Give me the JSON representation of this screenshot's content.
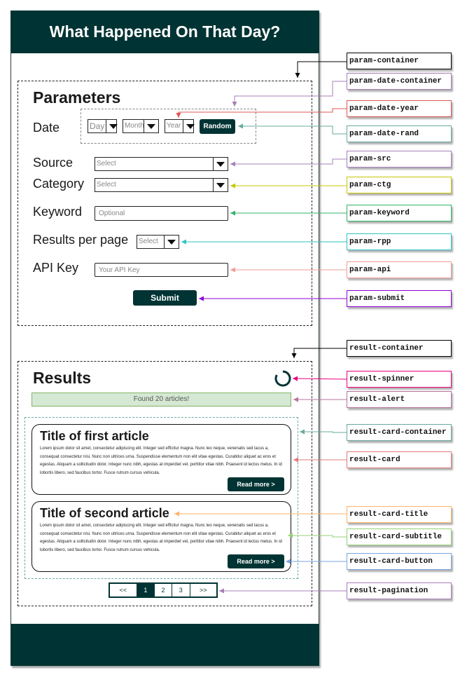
{
  "app": {
    "title": "What Happened On That Day?"
  },
  "colors": {
    "theme_dark": "#003333",
    "alert_bg": "#d5e8d4",
    "spinner": "#003333"
  },
  "parameters": {
    "heading": "Parameters",
    "date": {
      "label": "Date",
      "day_placeholder": "Day",
      "month_placeholder": "Month",
      "year_placeholder": "Year",
      "random_label": "Random"
    },
    "source": {
      "label": "Source",
      "placeholder": "Select"
    },
    "category": {
      "label": "Category",
      "placeholder": "Select"
    },
    "keyword": {
      "label": "Keyword",
      "placeholder": "Optional"
    },
    "results_per_page": {
      "label": "Results per page",
      "placeholder": "Select"
    },
    "api_key": {
      "label": "API Key",
      "placeholder": "Your API Key"
    },
    "submit_label": "Submit"
  },
  "results": {
    "heading": "Results",
    "alert": "Found 20 articles!",
    "spinner_icon": "loading-spinner-icon",
    "cards": [
      {
        "title": "Title of first article",
        "text": "Lorem ipsum dolor sit amet, consectetur adipiscing elit. Integer sed efficitur magna. Nunc leo neque, venenatis sed lacus a, consequat consectetur nisi. Nunc non ultrices urna. Suspendisse elementum non elit vitae egestas. Curabitur aliquet ac eros et egestas. Aliquam a sollicitudin dolor. Integer nunc nibh, egestas at imperdiet vel, porttitor vitae nibh. Praesent id lectus metus. In id lobortis libero, sed faucibus tortor. Fusce rutrum cursus vehicula.",
        "button": "Read more >"
      },
      {
        "title": "Title of second article",
        "text": "Lorem ipsum dolor sit amet, consectetur adipiscing elit. Integer sed efficitur magna. Nunc leo neque, venenatis sed lacus a, consequat consectetur nisi. Nunc non ultrices urna. Suspendisse elementum non elit vitae egestas. Curabitur aliquet ac eros et egestas. Aliquam a sollicitudin dolor. Integer nunc nibh, egestas at imperdiet vel, porttitor vitae nibh. Praesent id lectus metus. In id lobortis libero, sed faucibus tortor. Fusce rutrum cursus vehicula.",
        "button": "Read more >"
      }
    ],
    "pagination": [
      "<<",
      "1",
      "2",
      "3",
      ">>"
    ],
    "active_page": "1"
  },
  "annotations": [
    {
      "label": "param-container",
      "color": "#000000"
    },
    {
      "label": "param-date-container",
      "color": "#a680b8"
    },
    {
      "label": "param-date-year",
      "color": "#e05555"
    },
    {
      "label": "param-date-rand",
      "color": "#67ab9f"
    },
    {
      "label": "param-src",
      "color": "#a680b8"
    },
    {
      "label": "param-ctg",
      "color": "#c8c800"
    },
    {
      "label": "param-keyword",
      "color": "#33b36b"
    },
    {
      "label": "param-rpp",
      "color": "#2ec4c4"
    },
    {
      "label": "param-api",
      "color": "#f19c99"
    },
    {
      "label": "param-submit",
      "color": "#8f00d9"
    },
    {
      "label": "result-container",
      "color": "#000000"
    },
    {
      "label": "result-spinner",
      "color": "#e6007e"
    },
    {
      "label": "result-alert",
      "color": "#b5739d"
    },
    {
      "label": "result-card-container",
      "color": "#67ab9f"
    },
    {
      "label": "result-card",
      "color": "#e07a7a"
    },
    {
      "label": "result-card-title",
      "color": "#ffb366"
    },
    {
      "label": "result-card-subtitle",
      "color": "#97d077"
    },
    {
      "label": "result-card-button",
      "color": "#7ea6e0"
    },
    {
      "label": "result-pagination",
      "color": "#a680b8"
    }
  ]
}
